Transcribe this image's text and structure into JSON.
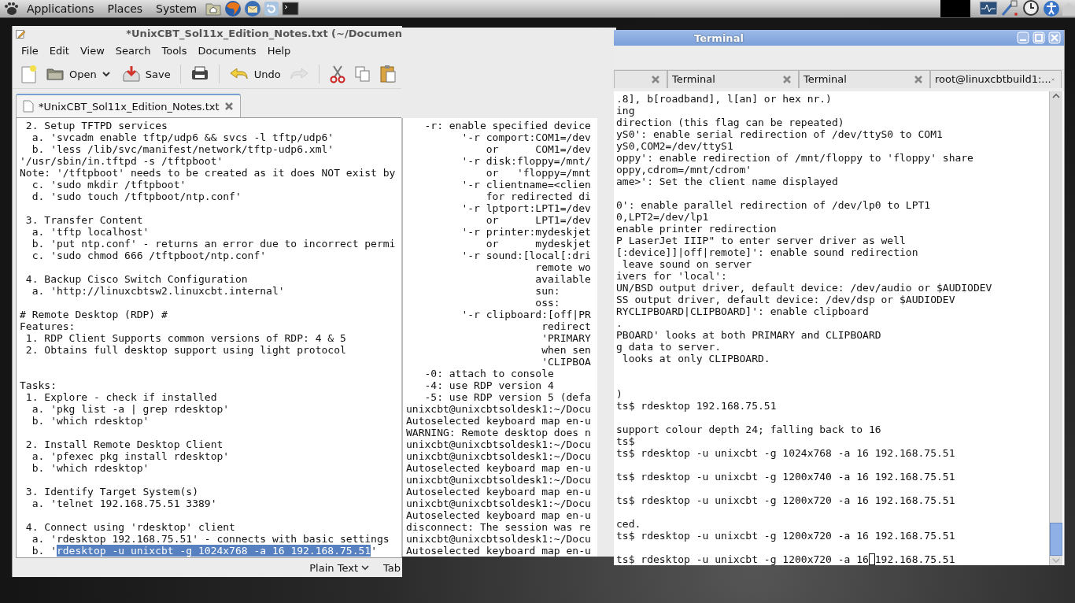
{
  "top_panel": {
    "menus": [
      "Applications",
      "Places",
      "System"
    ]
  },
  "editor": {
    "title": "*UnixCBT_Sol11x_Edition_Notes.txt (~/Documen",
    "menu": [
      "File",
      "Edit",
      "View",
      "Search",
      "Tools",
      "Documents",
      "Help"
    ],
    "toolbar": {
      "open": "Open",
      "save": "Save",
      "undo": "Undo",
      "redo_disabled": true
    },
    "tab": {
      "label": "*UnixCBT_Sol11x_Edition_Notes.txt"
    },
    "lines": [
      {
        "kind": "text",
        "text": " 2. Setup TFTPD services"
      },
      {
        "kind": "text",
        "text": "  a. 'svcadm enable tftp/udp6 && svcs -l tftp/udp6'"
      },
      {
        "kind": "text",
        "text": "  b. 'less /lib/svc/manifest/network/tftp-udp6.xml'"
      },
      {
        "kind": "text",
        "text": "'/usr/sbin/in.tftpd -s /tftpboot'"
      },
      {
        "kind": "text",
        "text": "Note: '/tftpboot' needs to be created as it does NOT exist by"
      },
      {
        "kind": "text",
        "text": "  c. 'sudo mkdir /tftpboot'"
      },
      {
        "kind": "text",
        "text": "  d. 'sudo touch /tftpboot/ntp.conf'"
      },
      {
        "kind": "blank"
      },
      {
        "kind": "text",
        "text": " 3. Transfer Content"
      },
      {
        "kind": "text",
        "text": "  a. 'tftp localhost'"
      },
      {
        "kind": "text",
        "text": "  b. 'put ntp.conf' - returns an error due to incorrect permi"
      },
      {
        "kind": "text",
        "text": "  c. 'sudo chmod 666 /tftpboot/ntp.conf'"
      },
      {
        "kind": "blank"
      },
      {
        "kind": "text",
        "text": " 4. Backup Cisco Switch Configuration"
      },
      {
        "kind": "text",
        "text": "  a. 'http://linuxcbtsw2.linuxcbt.internal'"
      },
      {
        "kind": "blank"
      },
      {
        "kind": "text",
        "text": "# Remote Desktop (RDP) #"
      },
      {
        "kind": "text",
        "text": "Features:"
      },
      {
        "kind": "text",
        "text": " 1. RDP Client Supports common versions of RDP: 4 & 5"
      },
      {
        "kind": "text",
        "text": " 2. Obtains full desktop support using light protocol"
      },
      {
        "kind": "blank"
      },
      {
        "kind": "blank"
      },
      {
        "kind": "text",
        "text": "Tasks:"
      },
      {
        "kind": "text",
        "text": " 1. Explore - check if installed"
      },
      {
        "kind": "text",
        "text": "  a. 'pkg list -a | grep rdesktop'"
      },
      {
        "kind": "text",
        "text": "  b. 'which rdesktop'"
      },
      {
        "kind": "blank"
      },
      {
        "kind": "text",
        "text": " 2. Install Remote Desktop Client"
      },
      {
        "kind": "text",
        "text": "  a. 'pfexec pkg install rdesktop'"
      },
      {
        "kind": "text",
        "text": "  b. 'which rdesktop'"
      },
      {
        "kind": "blank"
      },
      {
        "kind": "text",
        "text": " 3. Identify Target System(s)"
      },
      {
        "kind": "text",
        "text": "  a. 'telnet 192.168.75.51 3389'"
      },
      {
        "kind": "blank"
      },
      {
        "kind": "text",
        "text": " 4. Connect using 'rdesktop' client"
      },
      {
        "kind": "text",
        "text": "  a. 'rdesktop 192.168.75.51' - connects with basic settings"
      }
    ],
    "selection_line": {
      "before": "  b. '",
      "selection": "rdesktop -u unixcbt -g 1024x768 -a 16 192.168.75.51",
      "after": "'"
    },
    "status_bar": {
      "language": "Plain Text",
      "tab": "Tab"
    }
  },
  "middle_pane": {
    "lines": [
      "   -r: enable specified device",
      "         '-r comport:COM1=/dev",
      "             or      COM1=/dev",
      "         '-r disk:floppy=/mnt/",
      "             or   'floppy=/mnt",
      "         '-r clientname=<clien",
      "             for redirected di",
      "         '-r lptport:LPT1=/dev",
      "             or      LPT1=/dev",
      "         '-r printer:mydeskjet",
      "             or      mydeskjet",
      "         '-r sound:[local[:dri",
      "                     remote wo",
      "                     available",
      "                     sun:",
      "                     oss:",
      "         '-r clipboard:[off|PR",
      "                      redirect",
      "                      'PRIMARY",
      "                      when sen",
      "                      'CLIPBOA",
      "   -0: attach to console",
      "   -4: use RDP version 4",
      "   -5: use RDP version 5 (defa",
      "unixcbt@unixcbtsoldesk1:~/Docu",
      "Autoselected keyboard map en-u",
      "WARNING: Remote desktop does n",
      "unixcbt@unixcbtsoldesk1:~/Docu",
      "unixcbt@unixcbtsoldesk1:~/Docu",
      "Autoselected keyboard map en-u",
      "unixcbt@unixcbtsoldesk1:~/Docu",
      "Autoselected keyboard map en-u",
      "unixcbt@unixcbtsoldesk1:~/Docu",
      "Autoselected keyboard map en-u",
      "disconnect: The session was re",
      "unixcbt@unixcbtsoldesk1:~/Docu",
      "Autoselected keyboard map en-u"
    ]
  },
  "terminal": {
    "title": "Terminal",
    "tabs": [
      {
        "label": "Terminal"
      },
      {
        "label": "Terminal"
      },
      {
        "label": "root@linuxcbtbuild1:..."
      }
    ],
    "lines": [
      {
        "kind": "text",
        "text": ".8], b[roadband], l[an] or hex nr.)"
      },
      {
        "kind": "text",
        "text": "ing"
      },
      {
        "kind": "text",
        "text": "direction (this flag can be repeated)"
      },
      {
        "kind": "text",
        "text": "yS0': enable serial redirection of /dev/ttyS0 to COM1"
      },
      {
        "kind": "text",
        "text": "yS0,COM2=/dev/ttyS1"
      },
      {
        "kind": "text",
        "text": "oppy': enable redirection of /mnt/floppy to 'floppy' share"
      },
      {
        "kind": "text",
        "text": "oppy,cdrom=/mnt/cdrom'"
      },
      {
        "kind": "text",
        "text": "ame>': Set the client name displayed"
      },
      {
        "kind": "blank"
      },
      {
        "kind": "text",
        "text": "0': enable parallel redirection of /dev/lp0 to LPT1"
      },
      {
        "kind": "text",
        "text": "0,LPT2=/dev/lp1"
      },
      {
        "kind": "text",
        "text": "enable printer redirection"
      },
      {
        "kind": "text",
        "text": "P LaserJet IIIP\" to enter server driver as well"
      },
      {
        "kind": "text",
        "text": "[:device]]|off|remote]': enable sound redirection"
      },
      {
        "kind": "text",
        "text": " leave sound on server"
      },
      {
        "kind": "text",
        "text": "ivers for 'local':"
      },
      {
        "kind": "text",
        "text": "UN/BSD output driver, default device: /dev/audio or $AUDIODEV"
      },
      {
        "kind": "text",
        "text": "SS output driver, default device: /dev/dsp or $AUDIODEV"
      },
      {
        "kind": "text",
        "text": "RYCLIPBOARD|CLIPBOARD]': enable clipboard"
      },
      {
        "kind": "text",
        "text": "."
      },
      {
        "kind": "text",
        "text": "PBOARD' looks at both PRIMARY and CLIPBOARD"
      },
      {
        "kind": "text",
        "text": "g data to server."
      },
      {
        "kind": "text",
        "text": " looks at only CLIPBOARD."
      },
      {
        "kind": "blank"
      },
      {
        "kind": "blank"
      },
      {
        "kind": "text",
        "text": ")"
      },
      {
        "kind": "text",
        "text": "ts$ rdesktop 192.168.75.51"
      },
      {
        "kind": "blank"
      },
      {
        "kind": "text",
        "text": "support colour depth 24; falling back to 16"
      },
      {
        "kind": "text",
        "text": "ts$"
      },
      {
        "kind": "text",
        "text": "ts$ rdesktop -u unixcbt -g 1024x768 -a 16 192.168.75.51"
      },
      {
        "kind": "blank"
      },
      {
        "kind": "text",
        "text": "ts$ rdesktop -u unixcbt -g 1200x740 -a 16 192.168.75.51"
      },
      {
        "kind": "blank"
      },
      {
        "kind": "text",
        "text": "ts$ rdesktop -u unixcbt -g 1200x720 -a 16 192.168.75.51"
      },
      {
        "kind": "blank"
      },
      {
        "kind": "text",
        "text": "ced."
      },
      {
        "kind": "text",
        "text": "ts$ rdesktop -u unixcbt -g 1200x720 -a 16 192.168.75.51"
      },
      {
        "kind": "blank"
      }
    ],
    "cursor_line": {
      "before": "ts$ rdesktop -u unixcbt -g 1200x720 -a 16",
      "after": " 192.168.75.51"
    }
  }
}
